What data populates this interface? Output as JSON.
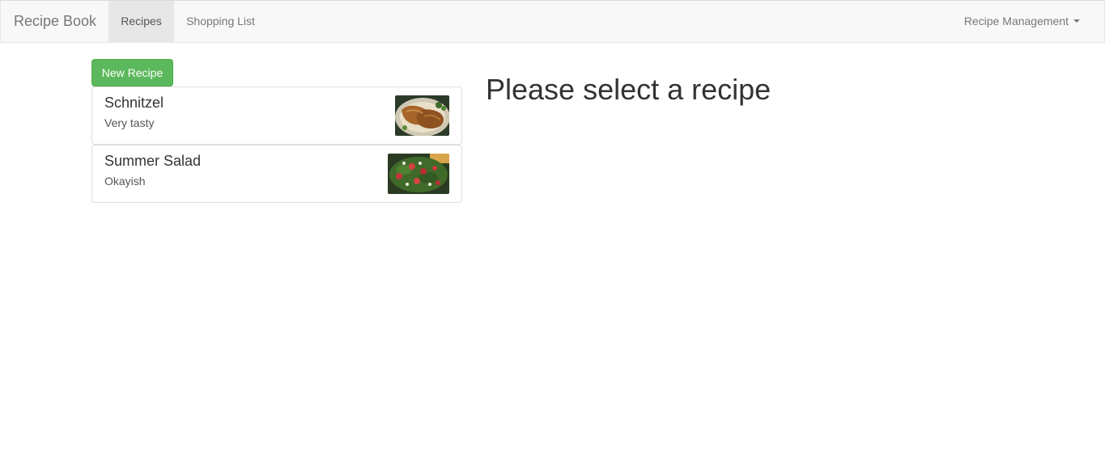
{
  "navbar": {
    "brand": "Recipe Book",
    "items": [
      {
        "label": "Recipes",
        "active": true
      },
      {
        "label": "Shopping List",
        "active": false
      }
    ],
    "dropdown_label": "Recipe Management"
  },
  "actions": {
    "new_recipe_label": "New Recipe"
  },
  "recipes": [
    {
      "name": "Schnitzel",
      "description": "Very tasty",
      "image": "schnitzel-photo"
    },
    {
      "name": "Summer Salad",
      "description": "Okayish",
      "image": "salad-photo"
    }
  ],
  "main": {
    "heading": "Please select a recipe"
  },
  "colors": {
    "navbar_bg": "#f8f8f8",
    "active_tab_bg": "#e7e7e7",
    "success_button": "#5cb85c"
  }
}
